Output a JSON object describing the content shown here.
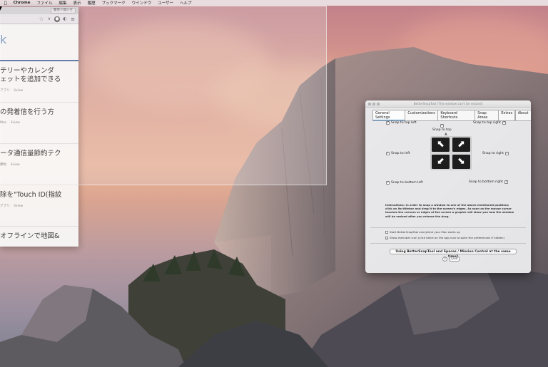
{
  "menubar": {
    "apple": "",
    "app_name": "Chrome",
    "items": [
      "ファイル",
      "編集",
      "表示",
      "履歴",
      "ブックマーク",
      "ウインドウ",
      "ユーザー",
      "ヘルプ"
    ]
  },
  "chrome_window": {
    "tab_button": "簡単ド開ジセ",
    "toolbar_icons": [
      "star-icon",
      "pocket-icon",
      "shield-icon",
      "evernote-icon",
      "menu-icon"
    ],
    "page_heading": "k",
    "articles": [
      {
        "title_line1": "テリーやカレンダ",
        "title_line2": "ェットを追加できる",
        "meta_tag": "アプリ",
        "meta_views": "3view"
      },
      {
        "title_line1": "の発着信を行う方",
        "title_line2": "",
        "meta_tag": "Mac",
        "meta_views": "3view"
      },
      {
        "title_line1": "ータ通信量節約テク",
        "title_line2": "",
        "meta_tag": "節約",
        "meta_views": "3view"
      },
      {
        "title_line1": "除を\"Touch ID(指紋",
        "title_line2": "",
        "meta_tag": "アプリ",
        "meta_views": "3view"
      },
      {
        "title_line1": "オフラインで地図&",
        "title_line2": "",
        "meta_tag": "",
        "meta_views": ""
      }
    ]
  },
  "bst_window": {
    "title": "BetterSnapTool (This window can't be resized)",
    "tabs": [
      "General Settings",
      "Customizations",
      "Keyboard Shortcuts",
      "Snap Areas",
      "Extras",
      "About"
    ],
    "active_tab": "General Settings",
    "checks": {
      "top_left": "Snap to top left",
      "top": "Snap to top",
      "top_right": "Snap to top right",
      "left": "Snap to left",
      "right": "Snap to right",
      "bottom_left": "Snap to bottom left",
      "bottom_right": "Snap to bottom right"
    },
    "arrow_icons": [
      "arrow-up-left-icon",
      "arrow-up-right-icon",
      "arrow-down-left-icon",
      "arrow-down-right-icon"
    ],
    "instructions": "Instructions: In order to snap a window to one of the above mentioned positions click on its titlebar and drag it to the screen's edges. As soon as the mouse cursor touches the corners or edges of the screen a graphic will show you how the window will be resized after you release the drag.",
    "options": [
      {
        "label": "Start BetterSnapTool everytime your Mac starts up",
        "checked": false
      },
      {
        "label": "Show menubar icon (click twice on the app icon to open the preferences if hidden)",
        "checked": true
      }
    ],
    "spaces_button": "Using BetterSnapTool and Spaces / Mission Control at the same time?",
    "help_button": "?",
    "quit_button": "Quit"
  }
}
